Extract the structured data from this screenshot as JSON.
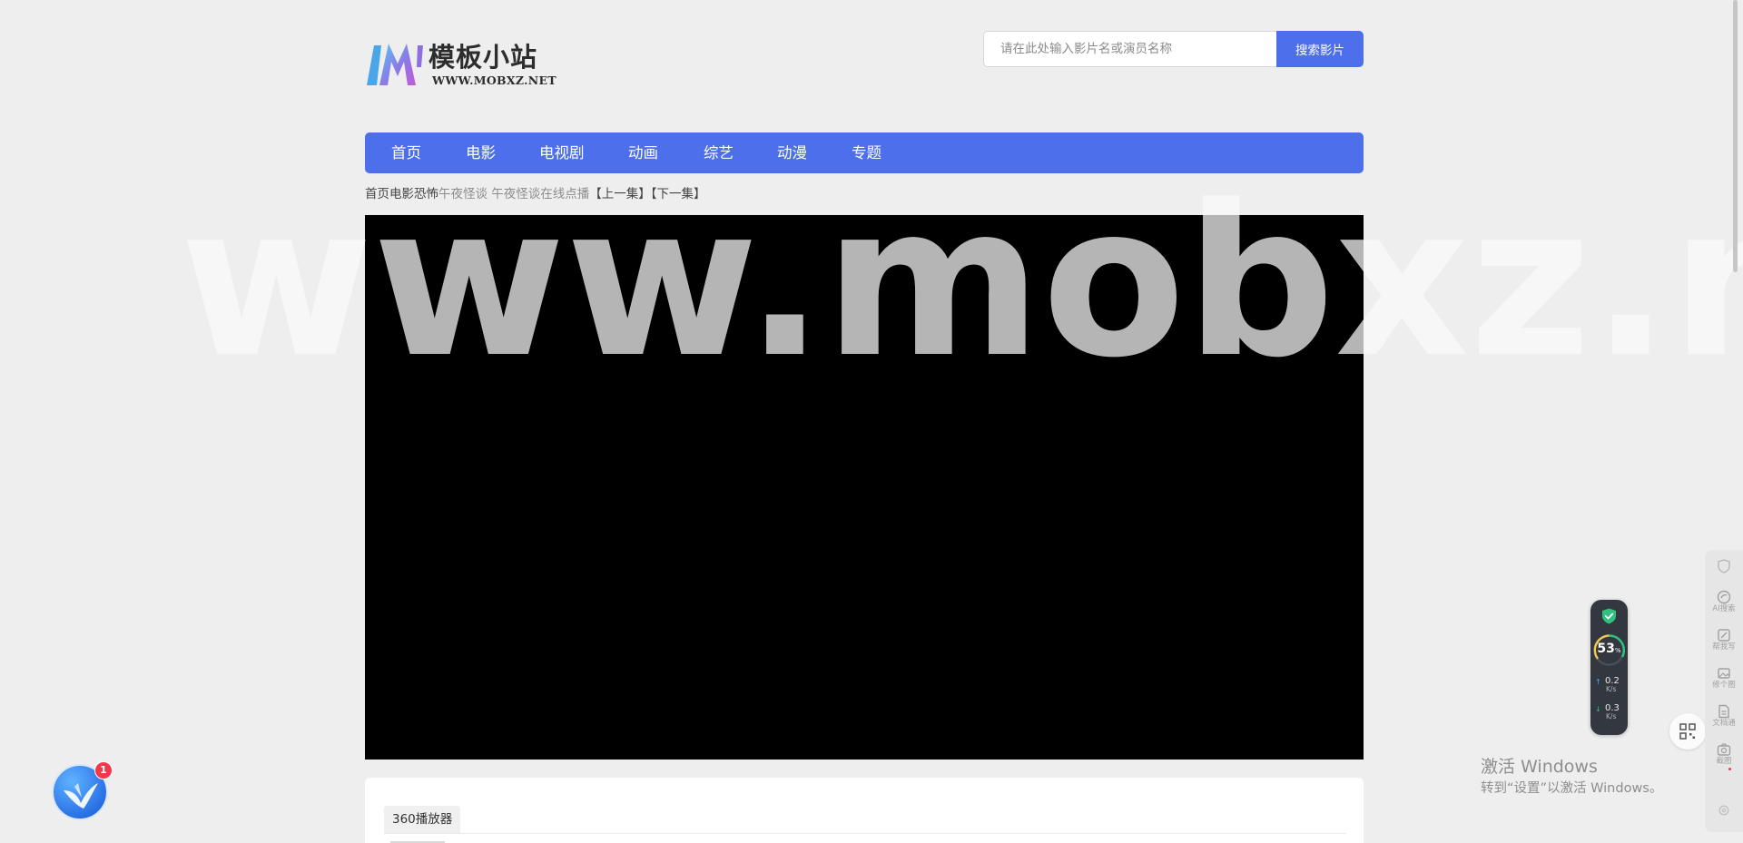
{
  "site": {
    "logo_title": "模板小站",
    "logo_url": "WWW.MOBXZ.NET"
  },
  "search": {
    "placeholder": "请在此处输入影片名或演员名称",
    "button_label": "搜索影片"
  },
  "nav": {
    "items": [
      {
        "label": "首页"
      },
      {
        "label": "电影"
      },
      {
        "label": "电视剧"
      },
      {
        "label": "动画"
      },
      {
        "label": "综艺"
      },
      {
        "label": "动漫"
      },
      {
        "label": "专题"
      }
    ]
  },
  "breadcrumb": {
    "home": "首页",
    "category": "电影",
    "genre": "恐怖",
    "title": "午夜怪谈",
    "current": "午夜怪谈在线点播",
    "prev": "【上一集】",
    "next": "【下一集】"
  },
  "player_panel": {
    "source_tab": "360播放器"
  },
  "watermark": {
    "text": "www.mobxz.net"
  },
  "windows_activation": {
    "title": "激活 Windows",
    "subtitle": "转到“设置”以激活 Windows。"
  },
  "network_monitor": {
    "percent": "53",
    "percent_unit": "%",
    "upload_value": "0.2",
    "download_value": "0.3",
    "unit": "K/s"
  },
  "browser_sidebar": {
    "items": [
      {
        "label": "AI搜索",
        "icon": "ai-search-icon"
      },
      {
        "label": "帮我写",
        "icon": "write-icon"
      },
      {
        "label": "修个图",
        "icon": "image-edit-icon"
      },
      {
        "label": "文档通",
        "icon": "document-icon"
      },
      {
        "label": "截图",
        "icon": "screenshot-icon"
      }
    ]
  },
  "assistant": {
    "badge_count": "1"
  },
  "colors": {
    "accent": "#4d6fec",
    "page_background": "#eeeeee",
    "player_background": "#000000"
  }
}
